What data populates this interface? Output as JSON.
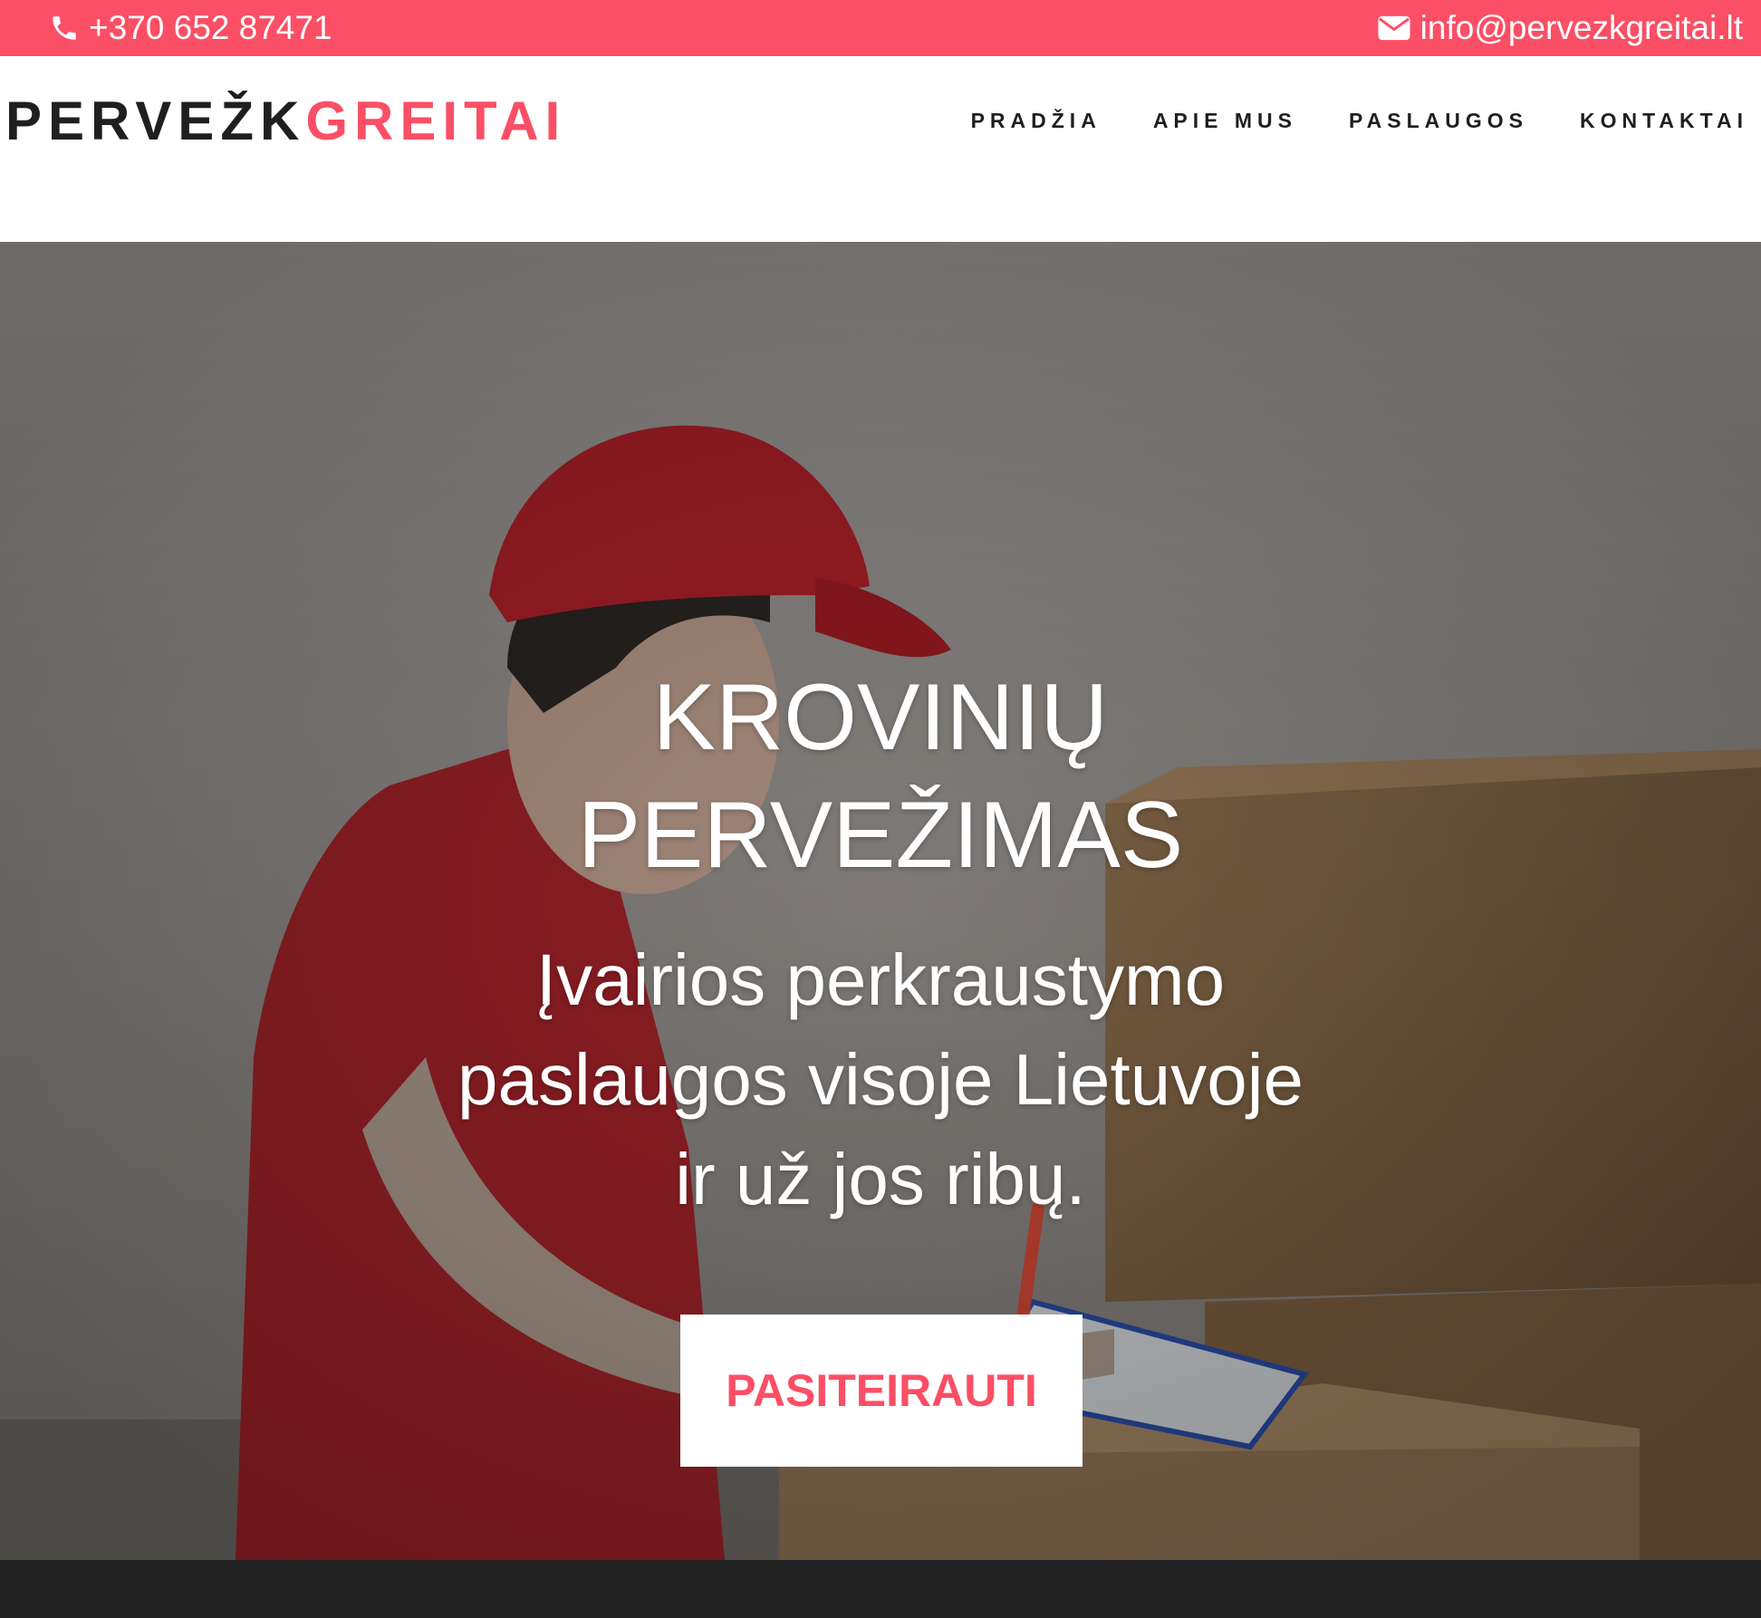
{
  "topbar": {
    "phone": "+370 652 87471",
    "email": "info@pervezkgreitai.lt",
    "icons": [
      "phone-icon",
      "envelope-icon"
    ]
  },
  "header": {
    "logo_dark": "PERVEŽK",
    "logo_accent": "GREITAI",
    "nav": [
      {
        "label": "PRADŽIA"
      },
      {
        "label": "APIE MUS"
      },
      {
        "label": "PASLAUGOS"
      },
      {
        "label": "KONTAKTAI"
      }
    ]
  },
  "hero": {
    "title_line1": "KROVINIŲ",
    "title_line2": "PERVEŽIMAS",
    "subtitle_line1": "Įvairios perkraustymo",
    "subtitle_line2": "paslaugos visoje Lietuvoje",
    "subtitle_line3": "ir už jos ribų.",
    "cta_label": "PASITEIRAUTI"
  },
  "colors": {
    "accent": "#fb4f66",
    "text_dark": "#1f1f1f",
    "footer": "#222222"
  }
}
